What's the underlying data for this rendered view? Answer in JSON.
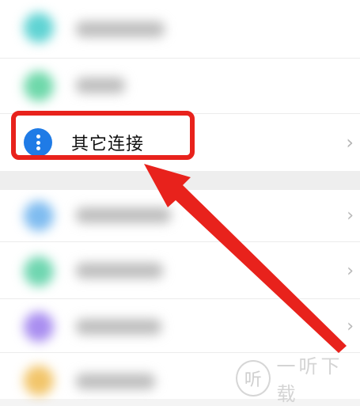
{
  "list": {
    "highlighted_item": {
      "label": "其它连接",
      "icon": "more-vertical-icon",
      "icon_color": "#1f7be6"
    },
    "blurred_item_colors": [
      "#5fd3d3",
      "#6ed8aa",
      "#7fbcf0",
      "#6fd6b0",
      "#a98ef0",
      "#f2c56a"
    ]
  },
  "annotation": {
    "highlight_color": "#e8221c",
    "arrow_color": "#e8221c"
  },
  "watermark": {
    "logo": "听",
    "text": "一听下载"
  }
}
